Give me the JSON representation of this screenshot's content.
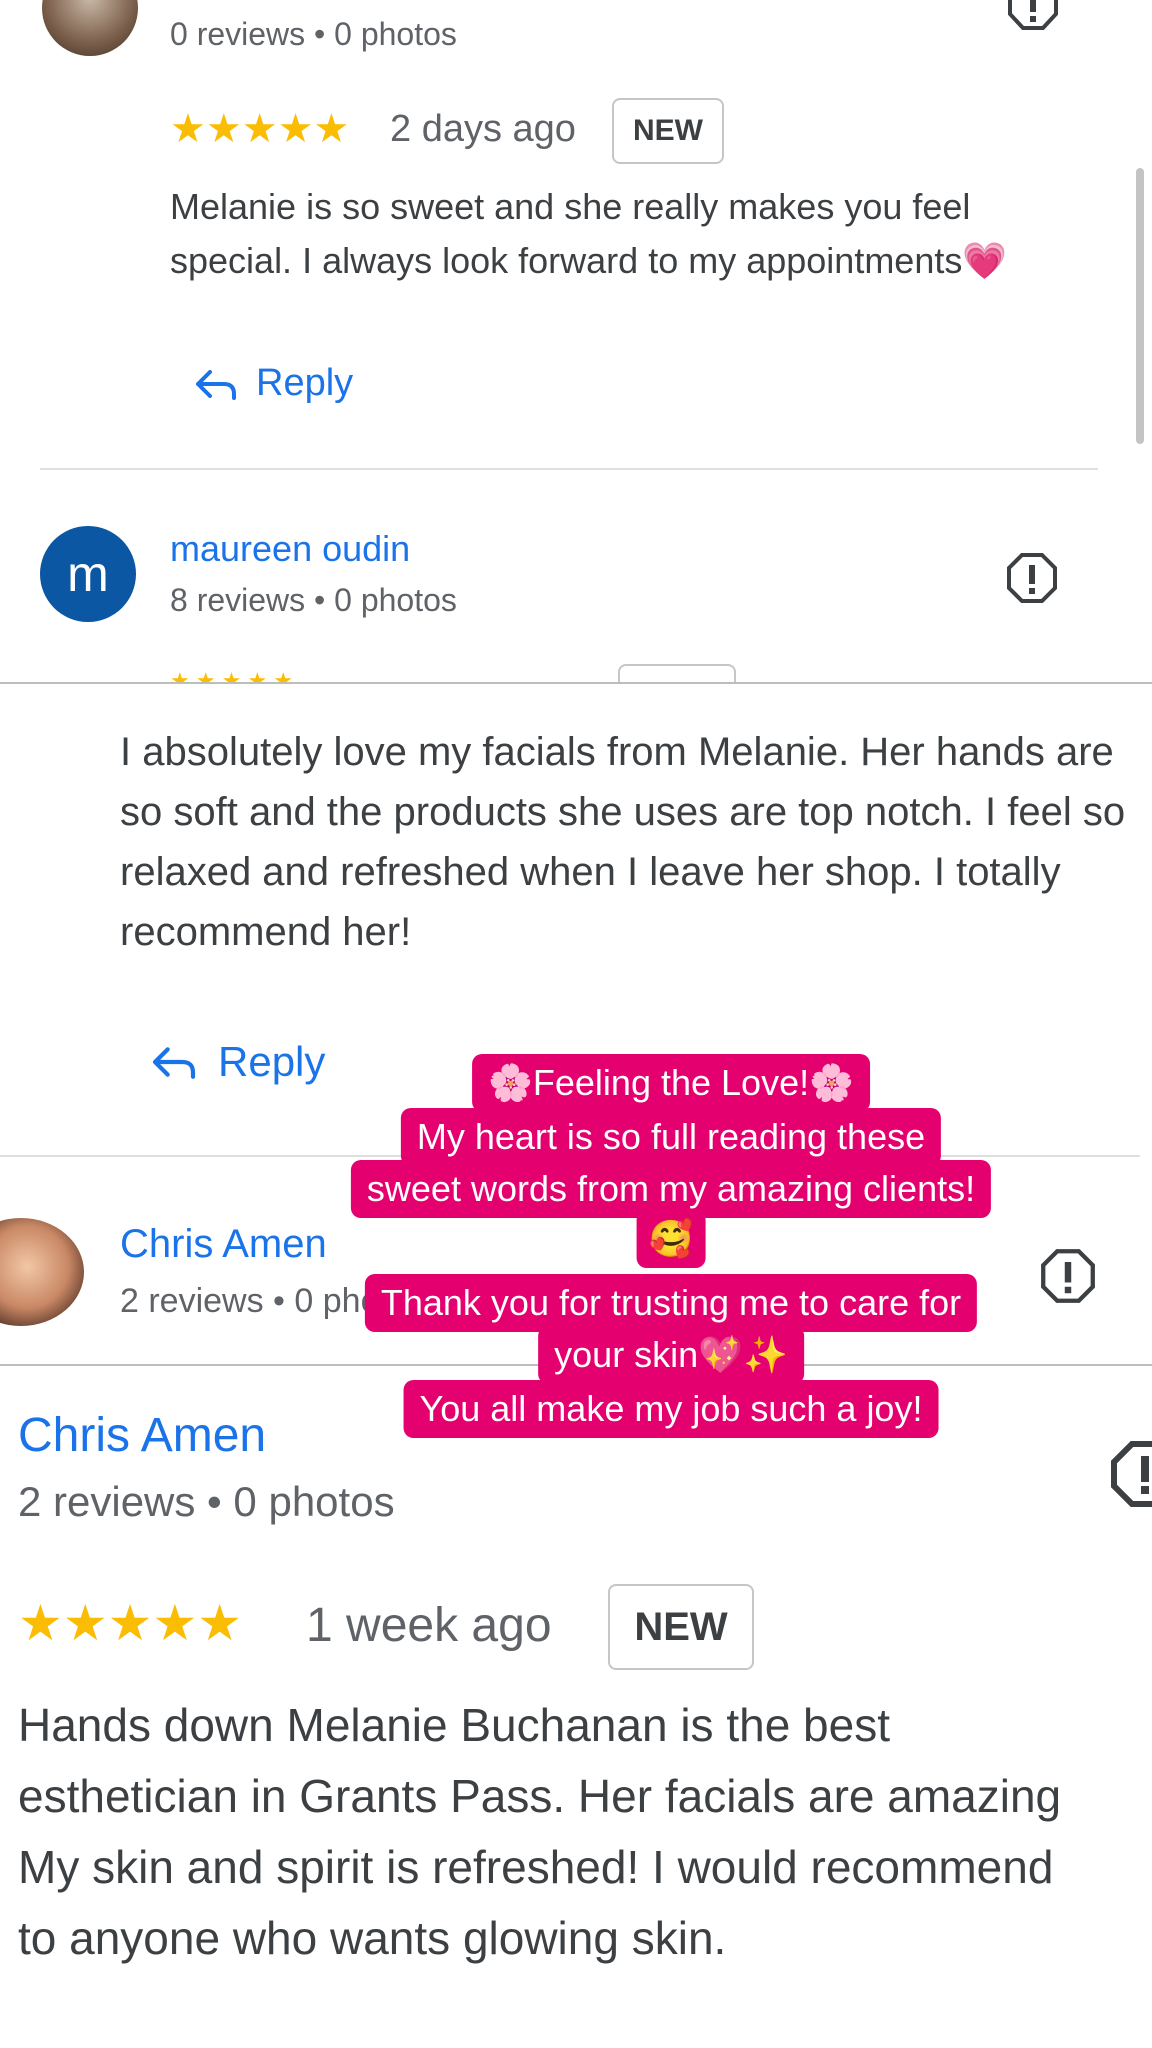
{
  "review_top": {
    "reviewer_meta": "0 reviews • 0 photos",
    "rating_stars": "★★★★★",
    "rating": 5,
    "date": "2 days ago",
    "badge": "NEW",
    "text": "Melanie is so sweet and she really makes you feel special. I always look forward to my appointments💗",
    "reply_label": "Reply"
  },
  "review_maureen": {
    "avatar_letter": "m",
    "name": "maureen oudin",
    "meta": "8 reviews • 0 photos",
    "text": "I absolutely love my facials from Melanie. Her hands are so soft and the products she uses are top notch. I feel so relaxed and refreshed when I leave her shop. I totally recommend her!",
    "reply_label": "Reply"
  },
  "review_chris_small": {
    "name": "Chris Amen",
    "meta": "2 reviews • 0 photos"
  },
  "review_chris_large": {
    "name": "Chris Amen",
    "meta": "2 reviews • 0 photos",
    "rating_stars": "★★★★★",
    "rating": 5,
    "date": "1 week ago",
    "badge": "NEW",
    "text_lines": [
      "Hands down Melanie Buchanan is the best",
      "esthetician in Grants Pass. Her facials are amazing",
      "My skin and spirit is refreshed! I would recommend",
      "to anyone who wants glowing skin."
    ]
  },
  "sticker": {
    "lines": [
      "🌸Feeling the Love!🌸",
      "My heart is so full reading these",
      "sweet words from my amazing clients!",
      "🥰",
      "Thank you for trusting me to care for",
      "your skin💖✨",
      "You all make my job such a joy!"
    ],
    "color": "#e5006f"
  },
  "colors": {
    "link_blue": "#1a73e8",
    "star_yellow": "#fbbc04",
    "avatar_blue": "#0b57a4"
  }
}
